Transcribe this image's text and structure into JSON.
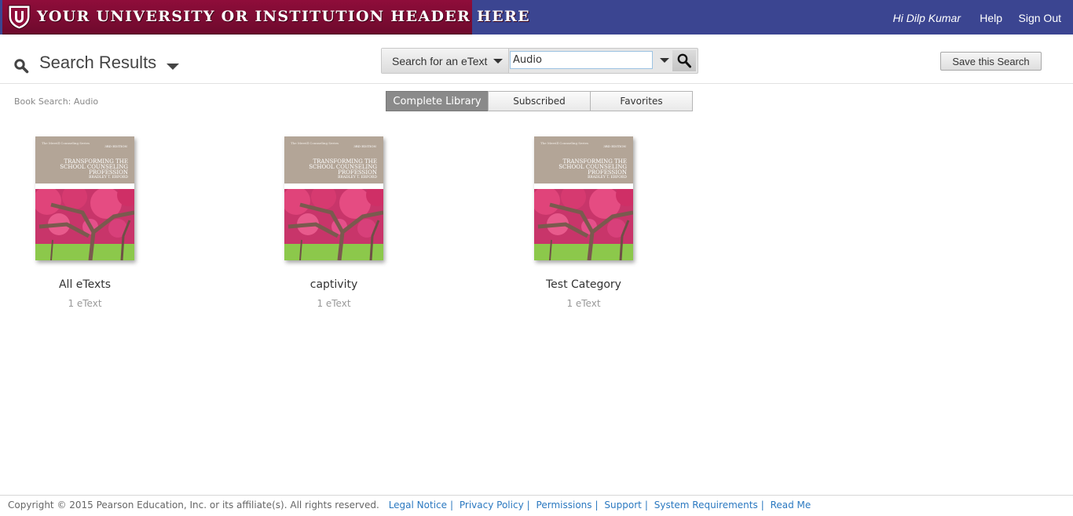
{
  "topbar": {
    "banner_title": "Your University or Institution Header Here",
    "user_greeting": "Hi Dilp Kumar",
    "help_label": "Help",
    "signout_label": "Sign Out"
  },
  "header": {
    "title": "Search Results",
    "search_scope_label": "Search for an eText",
    "search_value": "Audio",
    "save_search_label": "Save this Search"
  },
  "breadcrumb": "Book Search: Audio",
  "tabs": [
    {
      "label": "Complete Library",
      "active": true
    },
    {
      "label": "Subscribed",
      "active": false
    },
    {
      "label": "Favorites",
      "active": false
    }
  ],
  "book_cover": {
    "series": "The Merrill Counseling Series",
    "edition": "3RD EDITION",
    "title": "TRANSFORMING THE SCHOOL COUNSELING PROFESSION",
    "author": "BRADLEY T. ERFORD"
  },
  "collections": [
    {
      "name": "All eTexts",
      "count": "1 eText"
    },
    {
      "name": "captivity",
      "count": "1 eText"
    },
    {
      "name": "Test Category",
      "count": "1 eText"
    }
  ],
  "footer": {
    "copyright": "Copyright © 2015 Pearson Education, Inc. or its affiliate(s). All rights reserved.",
    "links": [
      "Legal Notice",
      "Privacy Policy",
      "Permissions",
      "Support",
      "System Requirements",
      "Read Me"
    ]
  },
  "colors": {
    "topbar": "#3b4591",
    "banner": "#8f0d3a",
    "active_tab": "#8a8a8a",
    "link": "#2a78c0"
  },
  "icons": [
    "shield-logo-icon",
    "search-results-icon",
    "chevron-down-icon",
    "magnifier-icon"
  ]
}
